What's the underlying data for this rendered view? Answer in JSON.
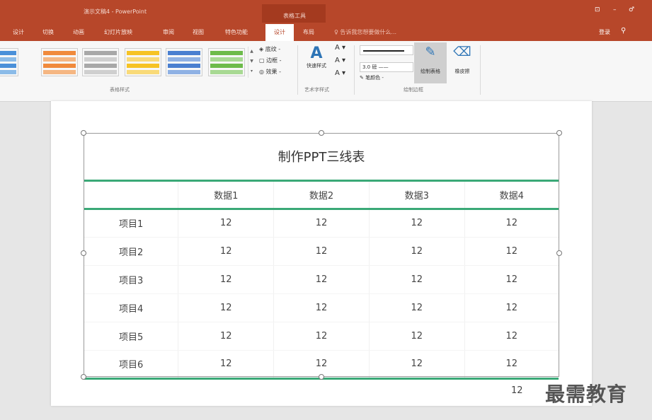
{
  "title_bar": {
    "doc_title": "演示文稿4 - PowerPoint",
    "context_tab": "表格工具",
    "window_controls": [
      "⊡",
      "–",
      "♂"
    ]
  },
  "tabs": [
    {
      "label": "设计"
    },
    {
      "label": "切换"
    },
    {
      "label": "动画"
    },
    {
      "label": "幻灯片放映"
    },
    {
      "label": "审阅"
    },
    {
      "label": "视图"
    },
    {
      "label": "特色功能"
    },
    {
      "label": "设计",
      "active": true
    },
    {
      "label": "布局"
    }
  ],
  "search_hint": "告诉我您想要做什么...",
  "account": {
    "login": "登录",
    "share_icon": "person-icon"
  },
  "ribbon": {
    "table_styles": {
      "label": "表格样式",
      "swatch_colors": [
        "#4a90d9",
        "#f08a3c",
        "#a8a8a8",
        "#f6c324",
        "#4a7fd0",
        "#6dbb4a"
      ]
    },
    "style_options": [
      "底纹 -",
      "边框 -",
      "效果 -"
    ],
    "wordart": {
      "label": "艺术字样式",
      "quick_style": "快速样式"
    },
    "borders": {
      "label": "绘制边框",
      "weight": "3.0 磅",
      "pen_color": "笔颜色 -",
      "draw_table": "绘制表格",
      "eraser": "橡皮擦"
    }
  },
  "table": {
    "title": "制作PPT三线表",
    "headers": [
      "",
      "数据1",
      "数据2",
      "数据3",
      "数据4"
    ],
    "rows": [
      [
        "项目1",
        "12",
        "12",
        "12",
        "12"
      ],
      [
        "项目2",
        "12",
        "12",
        "12",
        "12"
      ],
      [
        "项目3",
        "12",
        "12",
        "12",
        "12"
      ],
      [
        "项目4",
        "12",
        "12",
        "12",
        "12"
      ],
      [
        "项目5",
        "12",
        "12",
        "12",
        "12"
      ],
      [
        "项目6",
        "12",
        "12",
        "12",
        "12"
      ]
    ],
    "overflow_value": "12"
  },
  "watermark": "最需教育"
}
